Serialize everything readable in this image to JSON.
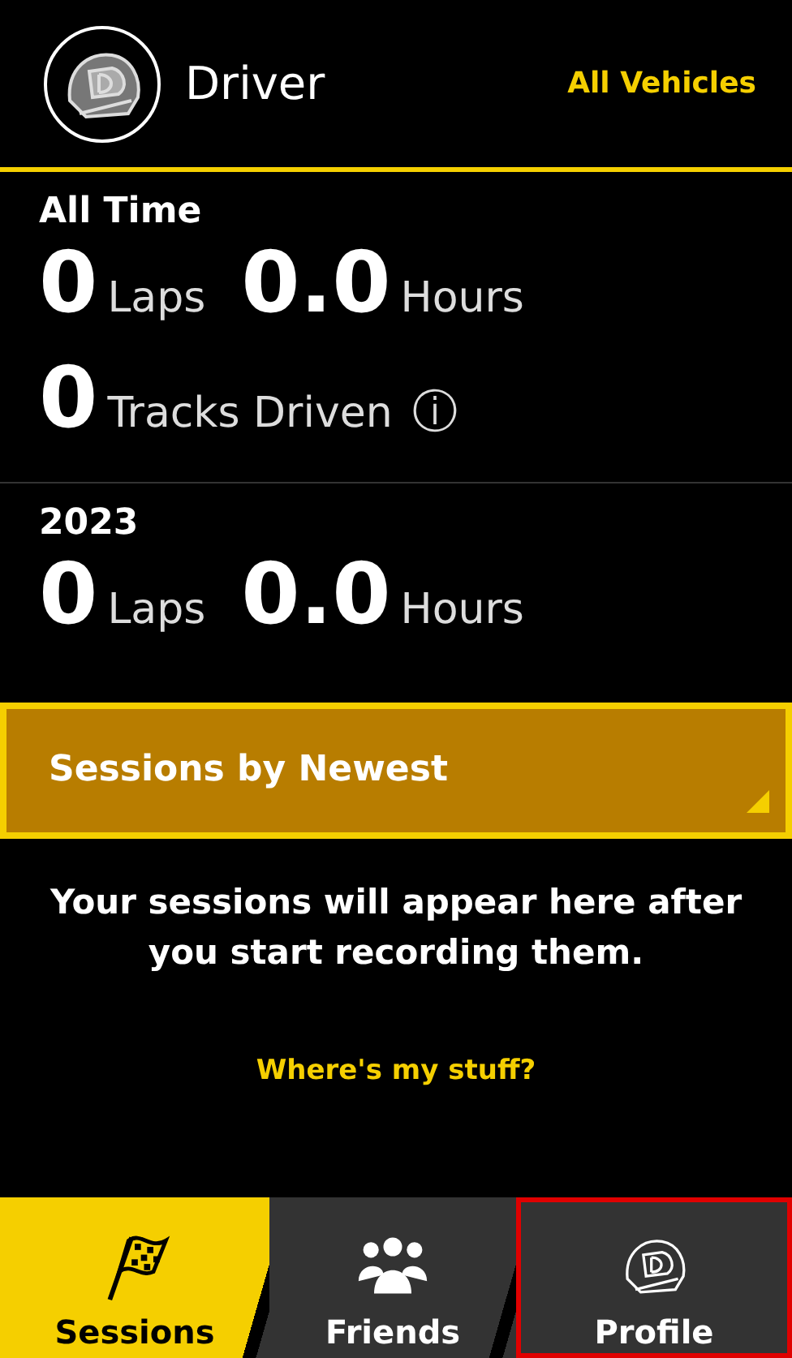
{
  "header": {
    "title": "Driver",
    "vehicles_link": "All Vehicles"
  },
  "all_time": {
    "title": "All Time",
    "stats": [
      {
        "value": "0",
        "unit": "Laps"
      },
      {
        "value": "0.0",
        "unit": "Hours"
      }
    ],
    "tracks": {
      "value": "0",
      "unit": "Tracks Driven",
      "info_icon": "ⓘ"
    }
  },
  "year": {
    "title": "2023",
    "stats": [
      {
        "value": "0",
        "unit": "Laps"
      },
      {
        "value": "0.0",
        "unit": "Hours"
      }
    ]
  },
  "sort_dropdown": {
    "label": "Sessions by Newest"
  },
  "empty_message": "Your sessions will appear here after you start recording them.",
  "help_link": "Where's my stuff?",
  "tabs": [
    {
      "label": "Sessions",
      "kind": "flag",
      "selected": true,
      "highlighted": false
    },
    {
      "label": "Friends",
      "kind": "people",
      "selected": false,
      "highlighted": false
    },
    {
      "label": "Profile",
      "kind": "helmet",
      "selected": false,
      "highlighted": true
    }
  ]
}
